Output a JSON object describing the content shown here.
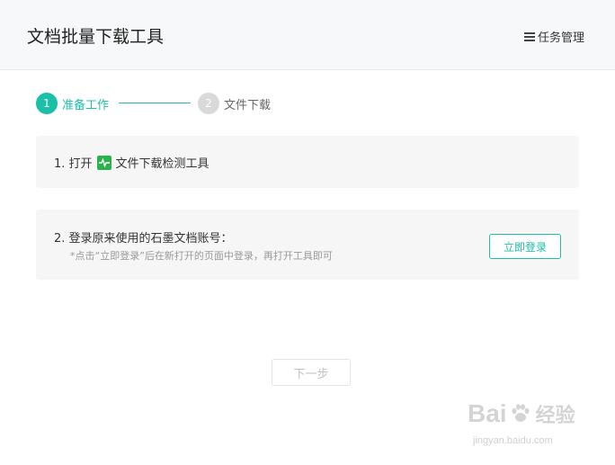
{
  "header": {
    "title": "文档批量下载工具",
    "task_manager": "任务管理"
  },
  "steps": [
    {
      "number": "1",
      "label": "准备工作",
      "state": "active"
    },
    {
      "number": "2",
      "label": "文件下载",
      "state": "inactive"
    }
  ],
  "card1": {
    "prefix": "1. 打开",
    "link_text": "文件下载检测工具"
  },
  "card2": {
    "text": "2. 登录原来使用的石墨文档账号：",
    "hint": "*点击“立即登录”后在新打开的页面中登录，再打开工具即可",
    "login_button": "立即登录"
  },
  "next_button": "下一步",
  "watermark": {
    "logo_left": "Bai",
    "logo_right": "经验",
    "url": "jingyan.baidu.com"
  },
  "colors": {
    "accent": "#1cbfa8",
    "tool_icon": "#2bb24c"
  },
  "icons": {
    "task_manager": "list-icon",
    "tool": "pulse-icon",
    "watermark": "paw-icon"
  }
}
